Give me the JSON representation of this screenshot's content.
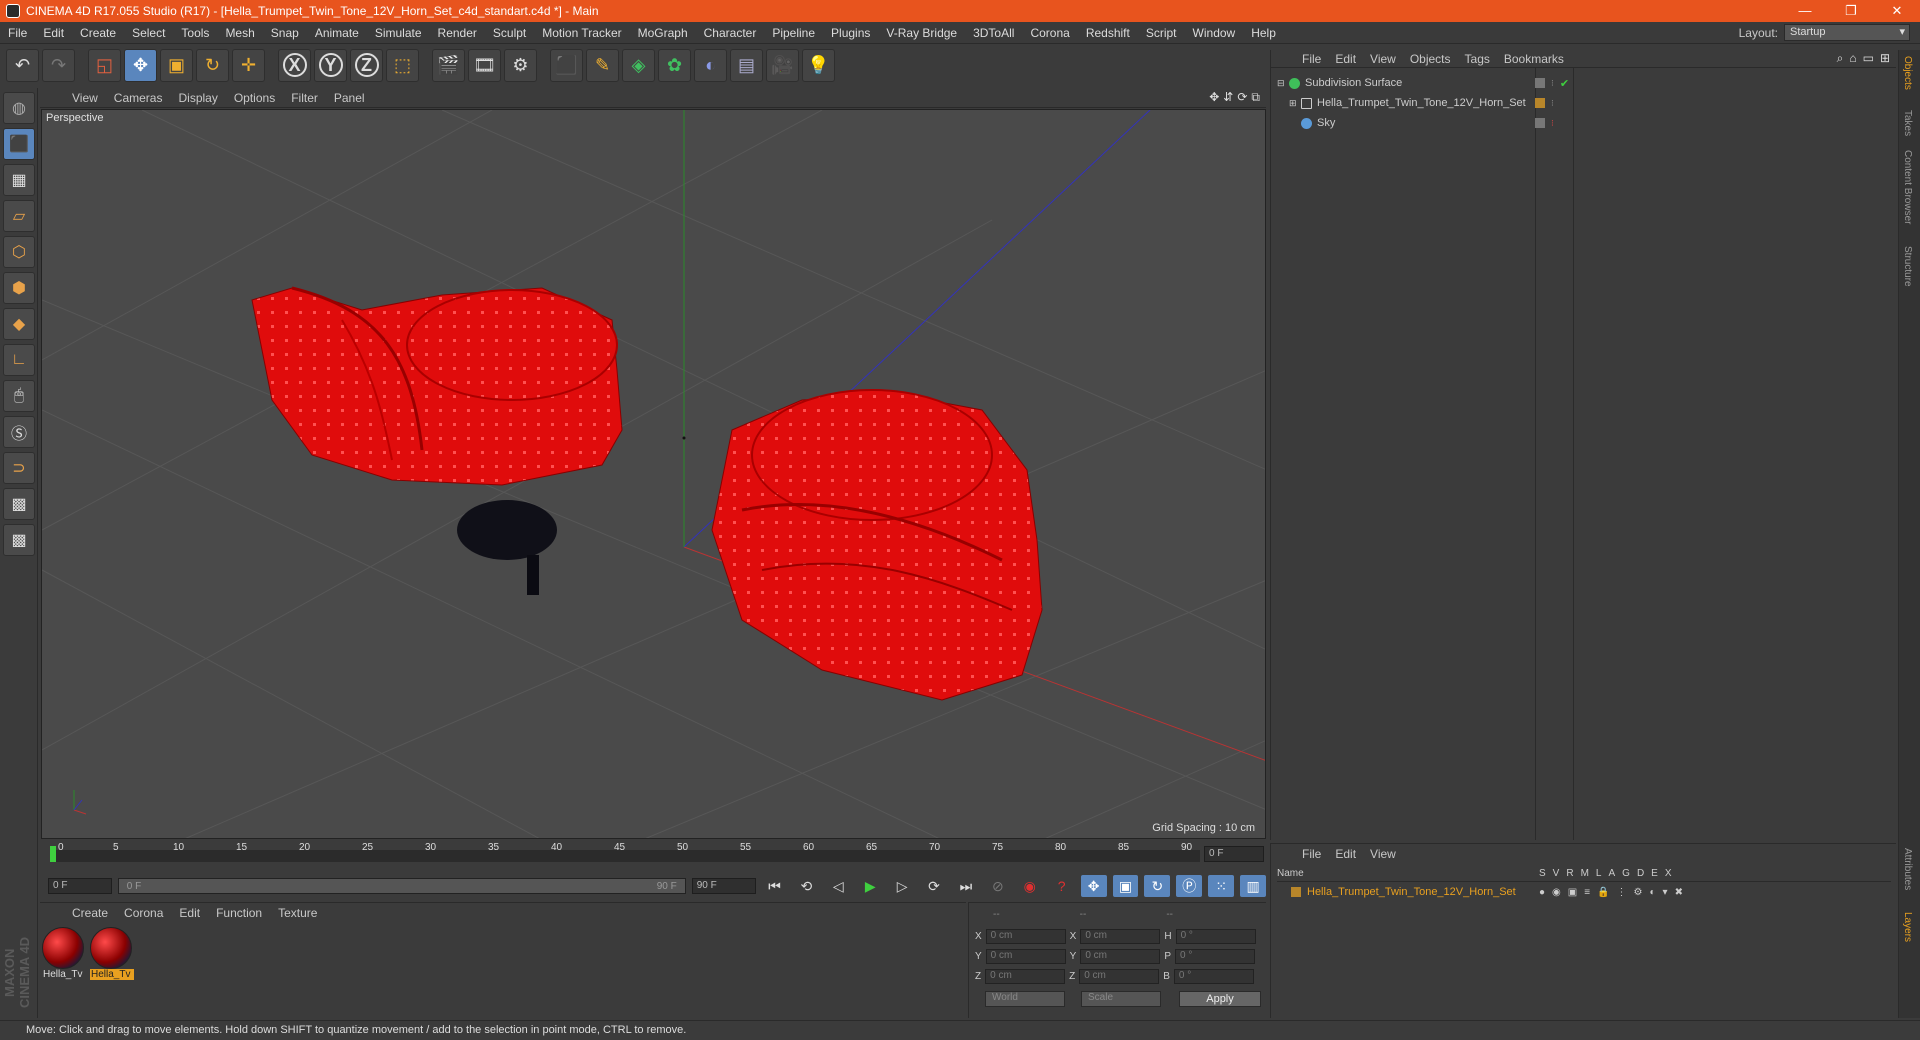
{
  "window": {
    "title": "CINEMA 4D R17.055 Studio (R17) - [Hella_Trumpet_Twin_Tone_12V_Horn_Set_c4d_standart.c4d *] - Main",
    "controls": [
      "—",
      "❐",
      "✕"
    ]
  },
  "menubar": {
    "items": [
      "File",
      "Edit",
      "Create",
      "Select",
      "Tools",
      "Mesh",
      "Snap",
      "Animate",
      "Simulate",
      "Render",
      "Sculpt",
      "Motion Tracker",
      "MoGraph",
      "Character",
      "Pipeline",
      "Plugins",
      "V-Ray Bridge",
      "3DToAll",
      "Corona",
      "Redshift",
      "Script",
      "Window",
      "Help"
    ],
    "layout_label": "Layout:",
    "layout_value": "Startup"
  },
  "toolbar": {
    "axis_x": "X",
    "axis_y": "Y",
    "axis_z": "Z"
  },
  "viewport": {
    "menu": [
      "View",
      "Cameras",
      "Display",
      "Options",
      "Filter",
      "Panel"
    ],
    "label": "Perspective",
    "grid_spacing": "Grid Spacing : 10 cm"
  },
  "timeline": {
    "ticks": [
      "0",
      "5",
      "10",
      "15",
      "20",
      "25",
      "30",
      "35",
      "40",
      "45",
      "50",
      "55",
      "60",
      "65",
      "70",
      "75",
      "80",
      "85",
      "90"
    ],
    "current_frame": "0 F"
  },
  "transport": {
    "start": "0 F",
    "range_start": "0 F",
    "range_end": "90 F",
    "end": "90 F"
  },
  "material_manager": {
    "menu": [
      "Create",
      "Corona",
      "Edit",
      "Function",
      "Texture"
    ],
    "materials": [
      {
        "label": "Hella_Tv",
        "selected": false
      },
      {
        "label": "Hella_Tv",
        "selected": true
      }
    ]
  },
  "coordinates": {
    "head": [
      "--",
      "--",
      "--"
    ],
    "rows": [
      {
        "a": "X",
        "av": "0 cm",
        "b": "X",
        "bv": "0 cm",
        "c": "H",
        "cv": "0 °"
      },
      {
        "a": "Y",
        "av": "0 cm",
        "b": "Y",
        "bv": "0 cm",
        "c": "P",
        "cv": "0 °"
      },
      {
        "a": "Z",
        "av": "0 cm",
        "b": "Z",
        "bv": "0 cm",
        "c": "B",
        "cv": "0 °"
      }
    ],
    "mode1": "World",
    "mode2": "Scale",
    "apply": "Apply"
  },
  "object_manager": {
    "menu": [
      "File",
      "Edit",
      "View",
      "Objects",
      "Tags",
      "Bookmarks"
    ],
    "objects": [
      {
        "name": "Subdivision Surface",
        "color": "#3fbf5a"
      },
      {
        "name": "Hella_Trumpet_Twin_Tone_12V_Horn_Set",
        "color": "#c8c8c8"
      },
      {
        "name": "Sky",
        "color": "#5a9ad8"
      }
    ]
  },
  "layer_manager": {
    "menu": [
      "File",
      "Edit",
      "View"
    ],
    "header_name": "Name",
    "header_cols": [
      "S",
      "V",
      "R",
      "M",
      "L",
      "A",
      "G",
      "D",
      "E",
      "X"
    ],
    "layer": "Hella_Trumpet_Twin_Tone_12V_Horn_Set"
  },
  "right_tabs": [
    "Objects",
    "Takes",
    "Content Browser",
    "Structure",
    "Attributes",
    "Layers"
  ],
  "status": "Move: Click and drag to move elements. Hold down SHIFT to quantize movement / add to the selection in point mode, CTRL to remove.",
  "logo": "MAXON CINEMA 4D"
}
